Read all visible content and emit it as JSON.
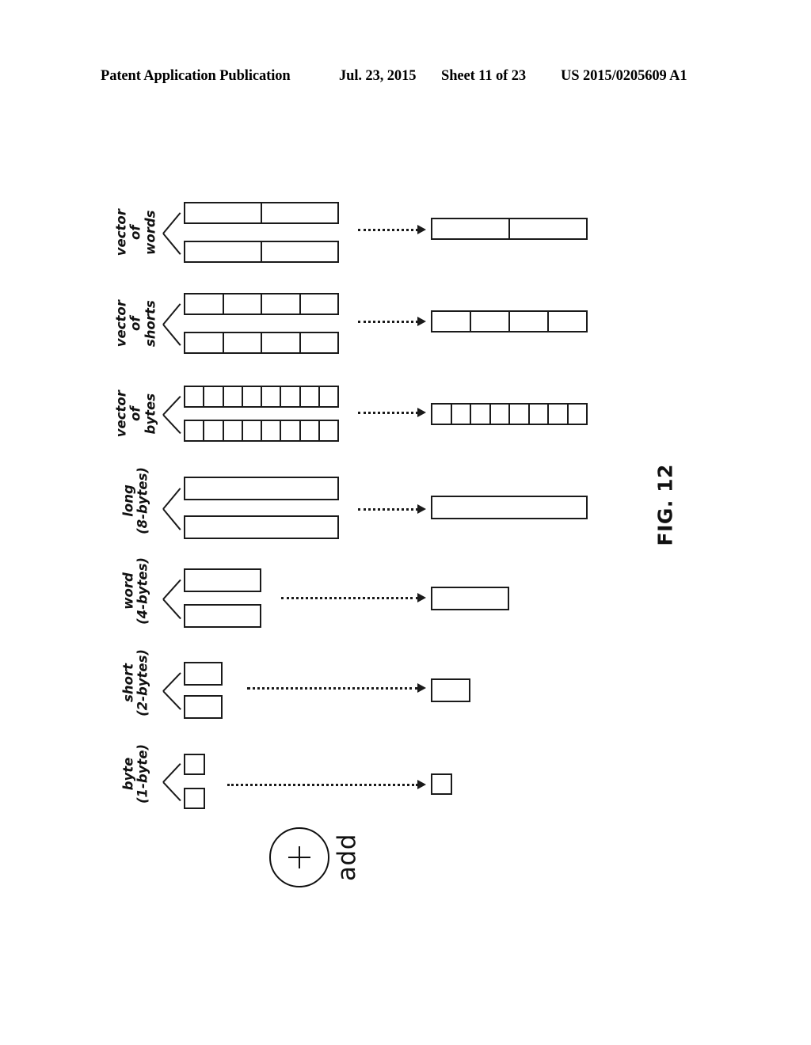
{
  "header": {
    "publication": "Patent Application Publication",
    "date": "Jul. 23, 2015",
    "sheet": "Sheet 11 of 23",
    "patent_number": "US 2015/0205609 A1"
  },
  "figure": {
    "caption": "FIG. 12",
    "operator": {
      "symbol": "+",
      "label": "add"
    },
    "rows": [
      {
        "id": "vector-of-words",
        "label_line1": "vector",
        "label_line2": "of",
        "label_line3": "words",
        "operand_cells": 2,
        "result_cells": 2,
        "operand_width": 196,
        "result_width": 198
      },
      {
        "id": "vector-of-shorts",
        "label_line1": "vector",
        "label_line2": "of",
        "label_line3": "shorts",
        "operand_cells": 4,
        "result_cells": 4,
        "operand_width": 196,
        "result_width": 198
      },
      {
        "id": "vector-of-bytes",
        "label_line1": "vector",
        "label_line2": "of",
        "label_line3": "bytes",
        "operand_cells": 8,
        "result_cells": 8,
        "operand_width": 196,
        "result_width": 198
      },
      {
        "id": "long",
        "label_line1": "long",
        "label_line2": "(8-bytes)",
        "label_line3": "",
        "operand_cells": 1,
        "result_cells": 1,
        "operand_width": 196,
        "result_width": 198
      },
      {
        "id": "word",
        "label_line1": "word",
        "label_line2": "(4-bytes)",
        "label_line3": "",
        "operand_cells": 1,
        "result_cells": 1,
        "operand_width": 98,
        "result_width": 99
      },
      {
        "id": "short",
        "label_line1": "short",
        "label_line2": "(2-bytes)",
        "label_line3": "",
        "operand_cells": 1,
        "result_cells": 1,
        "operand_width": 49,
        "result_width": 50
      },
      {
        "id": "byte",
        "label_line1": "byte",
        "label_line2": "(1-byte)",
        "label_line3": "",
        "operand_cells": 1,
        "result_cells": 1,
        "operand_width": 27,
        "result_width": 27
      }
    ]
  }
}
